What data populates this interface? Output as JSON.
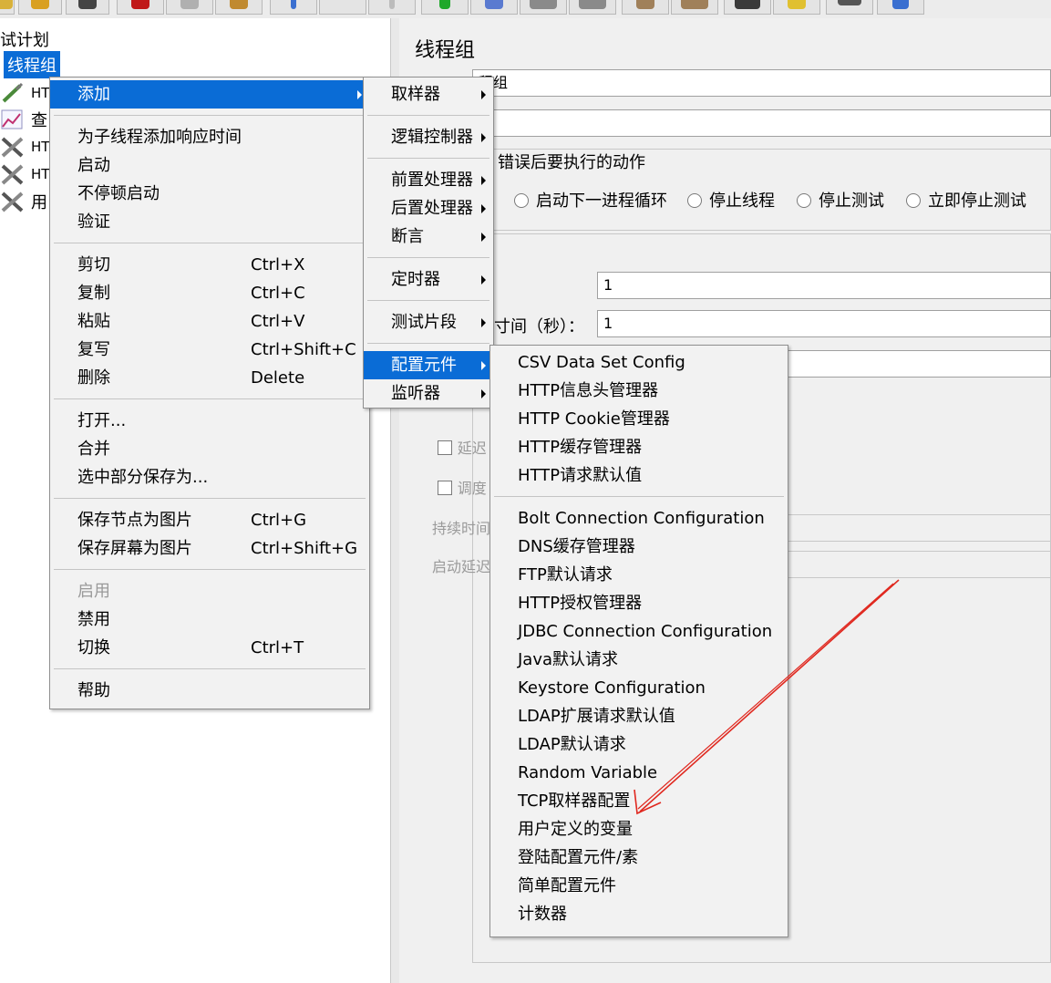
{
  "tree": {
    "root_label": "试计划",
    "thread_group_label": "线程组",
    "children": [
      {
        "label": "HT",
        "icon": "pipette-icon"
      },
      {
        "label": "查",
        "icon": "chart-icon"
      },
      {
        "label": "HT",
        "icon": "tools-icon"
      },
      {
        "label": "HT",
        "icon": "tools-icon"
      },
      {
        "label": "用",
        "icon": "tools-icon"
      }
    ]
  },
  "panel": {
    "title": "线程组",
    "name_value": "程组",
    "error_action_title": "错误后要执行的动作",
    "radio_options": [
      "启动下一进程循环",
      "停止线程",
      "停止测试",
      "立即停止测试"
    ],
    "threads_value": "1",
    "ramp_label": "寸间（秒）：",
    "ramp_value": "1",
    "delay_label": "延迟",
    "scheduler_label": "调度",
    "duration_label": "持续时间",
    "startup_delay_label": "启动延迟"
  },
  "context_menu": {
    "add": "添加",
    "add_response_time": "为子线程添加响应时间",
    "start": "启动",
    "start_no_pause": "不停顿启动",
    "validate": "验证",
    "cut": "剪切",
    "cut_sc": "Ctrl+X",
    "copy": "复制",
    "copy_sc": "Ctrl+C",
    "paste": "粘贴",
    "paste_sc": "Ctrl+V",
    "duplicate": "复写",
    "duplicate_sc": "Ctrl+Shift+C",
    "delete": "删除",
    "delete_sc": "Delete",
    "open": "打开...",
    "merge": "合并",
    "save_selection": "选中部分保存为...",
    "save_node_image": "保存节点为图片",
    "save_node_image_sc": "Ctrl+G",
    "save_screen_image": "保存屏幕为图片",
    "save_screen_image_sc": "Ctrl+Shift+G",
    "enable": "启用",
    "disable": "禁用",
    "toggle": "切换",
    "toggle_sc": "Ctrl+T",
    "help": "帮助"
  },
  "add_submenu": {
    "sampler": "取样器",
    "logic_controller": "逻辑控制器",
    "pre_processor": "前置处理器",
    "post_processor": "后置处理器",
    "assertion": "断言",
    "timer": "定时器",
    "test_fragment": "测试片段",
    "config_element": "配置元件",
    "listener": "监听器"
  },
  "config_submenu": {
    "group1": [
      "CSV Data Set Config",
      "HTTP信息头管理器",
      "HTTP Cookie管理器",
      "HTTP缓存管理器",
      "HTTP请求默认值"
    ],
    "group2": [
      "Bolt Connection Configuration",
      "DNS缓存管理器",
      "FTP默认请求",
      "HTTP授权管理器",
      "JDBC Connection Configuration",
      "Java默认请求",
      "Keystore Configuration",
      "LDAP扩展请求默认值",
      "LDAP默认请求",
      "Random Variable",
      "TCP取样器配置",
      "用户定义的变量",
      "登陆配置元件/素",
      "简单配置元件",
      "计数器"
    ]
  },
  "colors": {
    "selection": "#0a6cd6",
    "annotation_arrow": "#e0281f"
  }
}
